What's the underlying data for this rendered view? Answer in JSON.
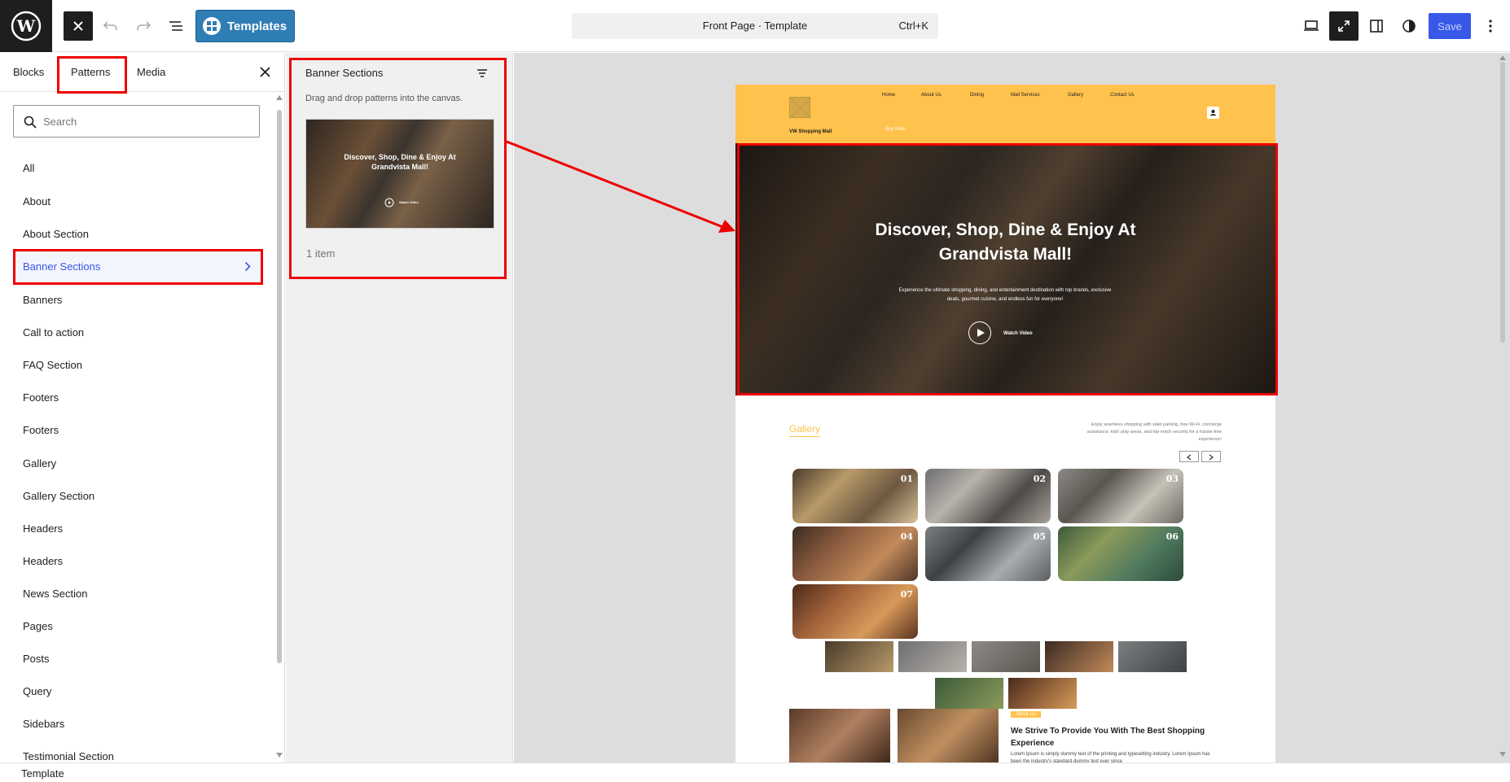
{
  "topbar": {
    "templates_label": "Templates",
    "command_title": "Front Page · Template",
    "command_shortcut": "Ctrl+K",
    "save_label": "Save"
  },
  "sidebar": {
    "tabs": [
      "Blocks",
      "Patterns",
      "Media"
    ],
    "search_placeholder": "Search",
    "categories": [
      "All",
      "About",
      "About Section",
      "Banner Sections",
      "Banners",
      "Call to action",
      "FAQ Section",
      "Footers",
      "Footers",
      "Gallery",
      "Gallery Section",
      "Headers",
      "Headers",
      "News Section",
      "Pages",
      "Posts",
      "Query",
      "Sidebars",
      "Testimonial Section"
    ]
  },
  "panel": {
    "title": "Banner Sections",
    "hint": "Drag and drop patterns into the canvas.",
    "count": "1 item",
    "thumb_title": "Discover, Shop, Dine & Enjoy At Grandvista Mall!",
    "thumb_btn": "Watch Video"
  },
  "site": {
    "nav": [
      "Home",
      "About Us",
      "Dining",
      "Mall Services",
      "Gallery",
      "Contact Us"
    ],
    "brand": "VW Shopping Mall",
    "buy_now": "Buy Now",
    "hero_title": "Discover, Shop, Dine & Enjoy At Grandvista Mall!",
    "hero_sub": "Experience the ultimate shopping, dining, and entertainment destination with top brands, exclusive deals, gourmet cuisine, and endless fun for everyone!",
    "watch_video": "Watch Video",
    "gallery_title": "Gallery",
    "gallery_desc": "Enjoy seamless shopping with valet parking, free Wi-Fi, concierge assistance, kids' play areas, and top-notch security for a hassle-free experience!",
    "gallery_nums": [
      "01",
      "02",
      "03",
      "04",
      "05",
      "06",
      "07"
    ],
    "about_badge": "About Us",
    "about_title": "We Strive To Provide You With The Best Shopping Experience",
    "about_text": "Lorem Ipsum is simply dummy text of the printing and typesetting industry. Lorem Ipsum has been the industry's standard dummy text ever since"
  },
  "status": {
    "breadcrumb": "Template"
  },
  "colors": {
    "accent": "#3858e9",
    "header_bg": "#ffc24d",
    "annotation": "#ee0000",
    "templates_btn": "#2f7db5"
  }
}
